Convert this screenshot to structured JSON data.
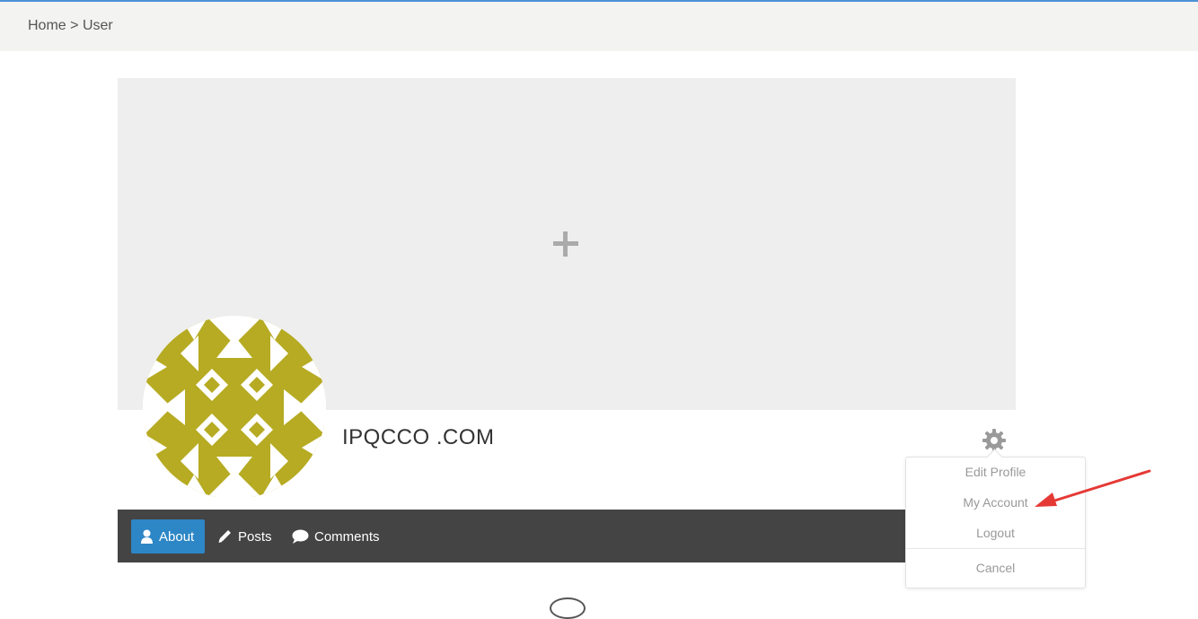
{
  "breadcrumb": {
    "home": "Home",
    "separator": ">",
    "current": "User"
  },
  "cover": {
    "add_icon": "plus-icon"
  },
  "profile": {
    "name": "IPQCCO .COM",
    "avatar_color": "#b6ab22"
  },
  "tabs": [
    {
      "label": "About",
      "icon": "user-icon",
      "active": true
    },
    {
      "label": "Posts",
      "icon": "pencil-icon",
      "active": false
    },
    {
      "label": "Comments",
      "icon": "comment-icon",
      "active": false
    }
  ],
  "menu": {
    "icon": "gear-icon",
    "items": [
      "Edit Profile",
      "My Account",
      "Logout"
    ],
    "cancel": "Cancel"
  },
  "colors": {
    "accent": "#2d86c6",
    "tabbar": "#444444",
    "annotation_arrow": "#e53935"
  }
}
